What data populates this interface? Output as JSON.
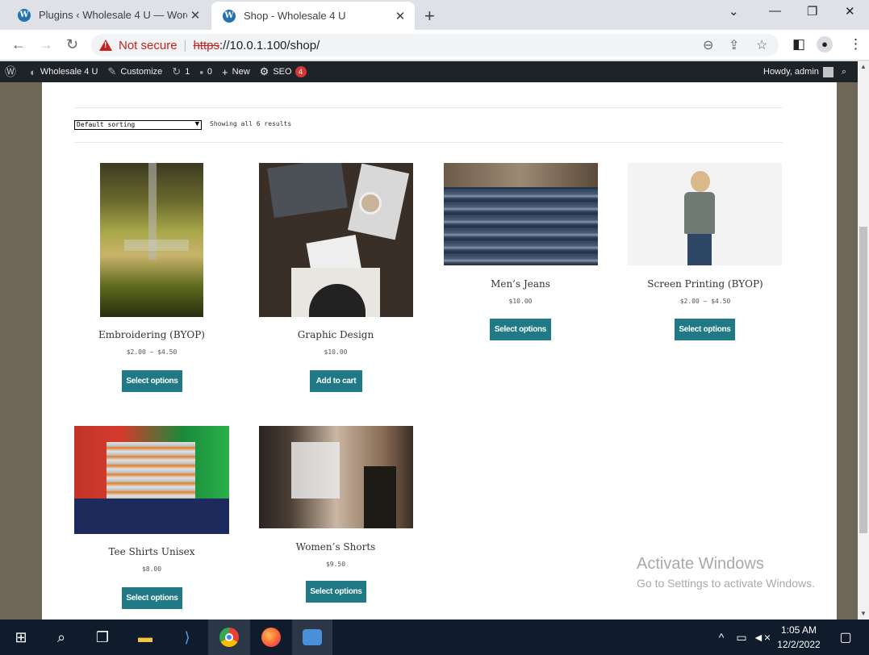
{
  "browser": {
    "tabs": [
      {
        "title": "Plugins ‹ Wholesale 4 U — WordPress",
        "active": false
      },
      {
        "title": "Shop - Wholesale 4 U",
        "active": true
      }
    ],
    "security_label": "Not secure",
    "url_scheme": "https",
    "url_rest": "://10.0.1.100/shop/"
  },
  "adminbar": {
    "site_name": "Wholesale 4 U",
    "customize": "Customize",
    "updates_count": "1",
    "comments_count": "0",
    "new_label": "New",
    "seo_label": "SEO",
    "seo_badge": "4",
    "howdy": "Howdy, admin"
  },
  "shop": {
    "sort_value": "Default sorting",
    "results_text": "Showing all 6 results",
    "products": [
      {
        "name": "Embroidering (BYOP)",
        "price": "$2.00 – $4.50",
        "button": "Select options"
      },
      {
        "name": "Graphic Design",
        "price": "$10.00",
        "button": "Add to cart"
      },
      {
        "name": "Men’s Jeans",
        "price": "$10.00",
        "button": "Select options"
      },
      {
        "name": "Screen Printing (BYOP)",
        "price": "$2.00 – $4.50",
        "button": "Select options"
      },
      {
        "name": "Tee Shirts Unisex",
        "price": "$8.00",
        "button": "Select options"
      },
      {
        "name": "Women’s Shorts",
        "price": "$9.50",
        "button": "Select options"
      }
    ]
  },
  "watermark": {
    "title": "Activate Windows",
    "subtitle": "Go to Settings to activate Windows."
  },
  "taskbar": {
    "time": "1:05 AM",
    "date": "12/2/2022"
  },
  "colors": {
    "button_teal": "#1f7a85",
    "adminbar_bg": "#1d2327",
    "not_secure_red": "#c5221f",
    "seo_badge_red": "#d63638"
  }
}
